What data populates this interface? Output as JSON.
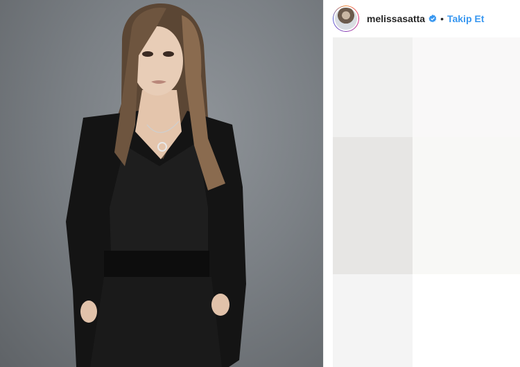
{
  "post": {
    "username": "melissasatta",
    "separator": "•",
    "follow_label": "Takip Et",
    "verified_icon": "verified-badge-icon",
    "accent_color": "#3897f0"
  }
}
